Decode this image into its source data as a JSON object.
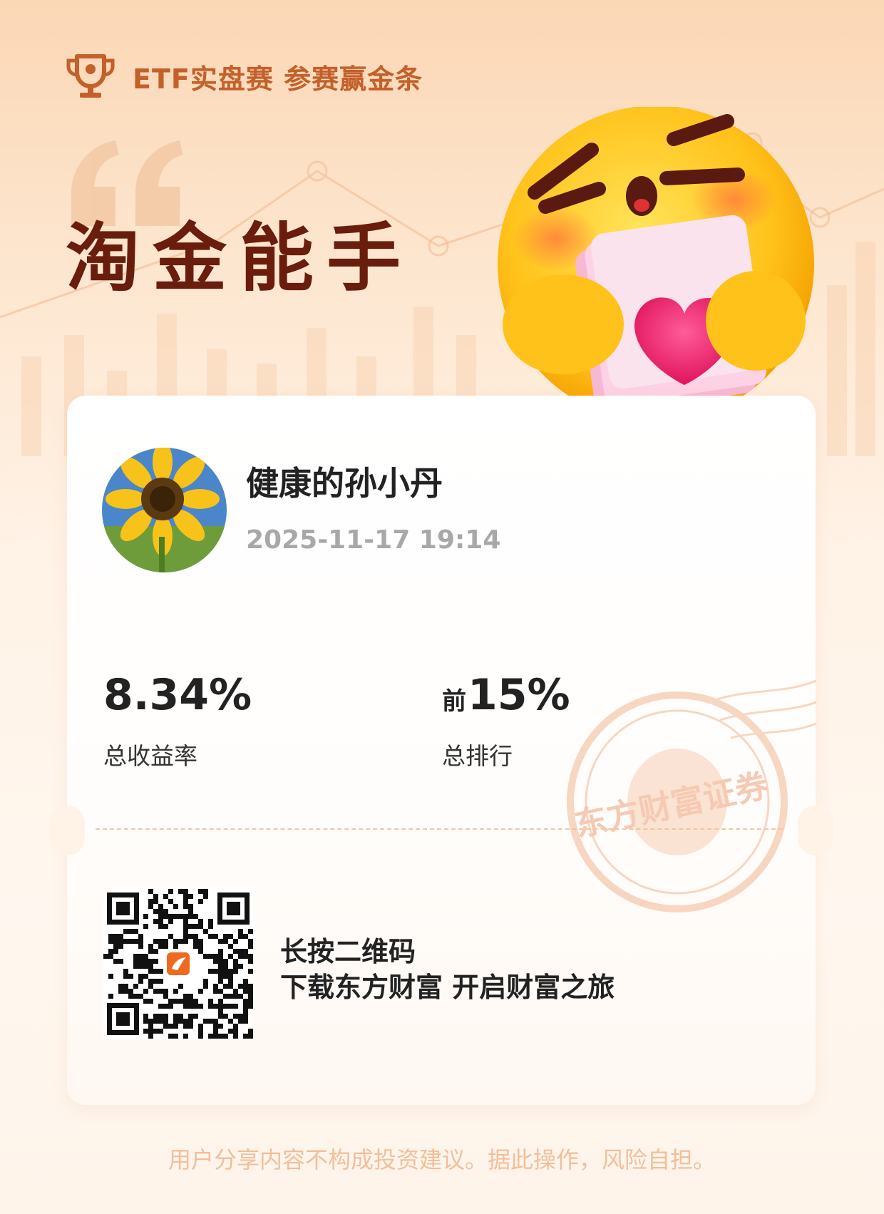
{
  "header": {
    "text": "ETF实盘赛 参赛赢金条",
    "accent_color": "#c4602a"
  },
  "badge": {
    "title": "淘金能手",
    "title_color": "#6a1d0d"
  },
  "user": {
    "name": "健康的孙小丹",
    "timestamp": "2025-11-17 19:14"
  },
  "stats": [
    {
      "prefix": "",
      "value": "8.34%",
      "label": "总收益率"
    },
    {
      "prefix": "前",
      "value": "15%",
      "label": "总排行"
    }
  ],
  "stamp": {
    "text": "东方财富证券"
  },
  "cta": {
    "line1": "长按二维码",
    "line2": "下载东方财富 开启财富之旅"
  },
  "disclaimer": "用户分享内容不构成投资建议。据此操作，风险自担。",
  "icons": {
    "trophy": "trophy-icon",
    "quote": "quote-icon",
    "emoji": "money-hug-emoji",
    "avatar": "sunflower-avatar",
    "qr": "qr-code",
    "app_logo": "eastmoney-logo-icon"
  }
}
